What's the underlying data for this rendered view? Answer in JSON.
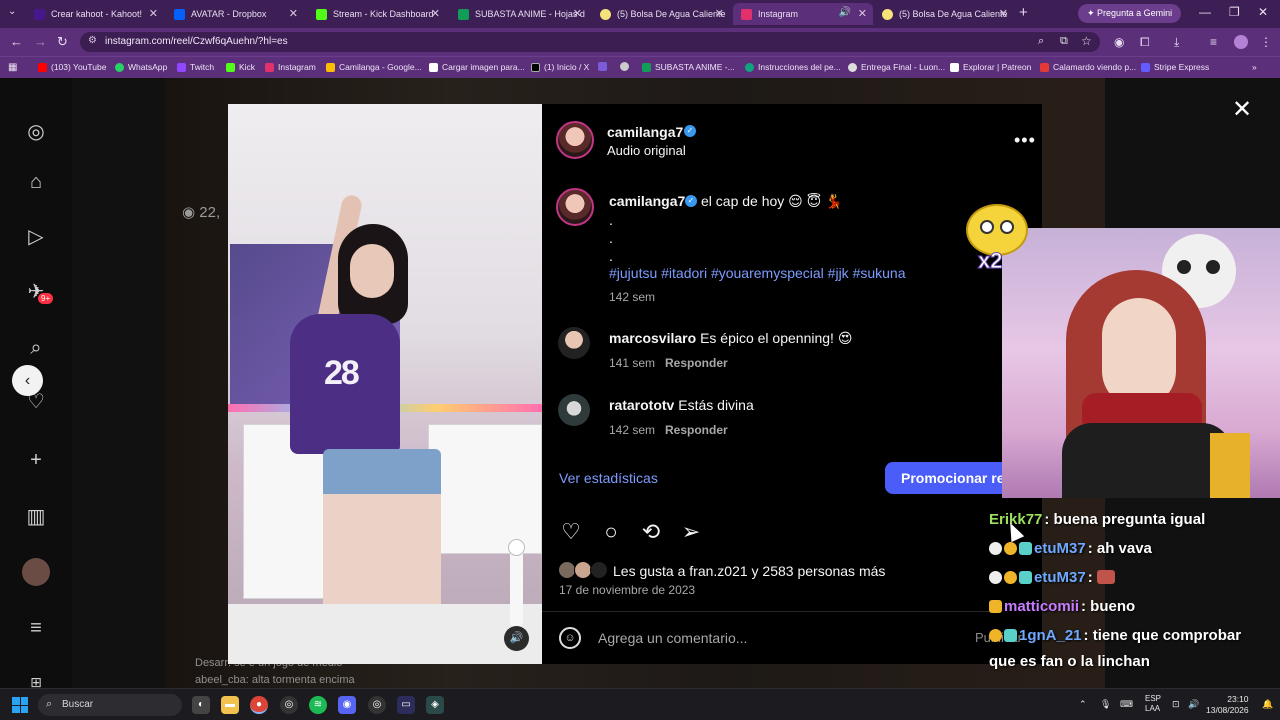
{
  "browser": {
    "tabs": [
      {
        "label": "Crear kahoot - Kahoot!",
        "color": "#46178f"
      },
      {
        "label": "AVATAR - Dropbox",
        "color": "#0061fe"
      },
      {
        "label": "Stream - Kick Dashboard",
        "color": "#53fc18"
      },
      {
        "label": "SUBASTA ANIME - Hojas d",
        "color": "#0f9d58"
      },
      {
        "label": "(5) Bolsa De Agua Caliente",
        "color": "#f5e27a"
      },
      {
        "label": "Instagram",
        "color": "#e1306c",
        "active": true
      },
      {
        "label": "(5) Bolsa De Agua Caliente",
        "color": "#f5e27a"
      }
    ],
    "new_tab": "+",
    "gemini_label": "Pregunta a Gemini",
    "url": "instagram.com/reel/Czwf6qAuehn/?hl=es",
    "bookmarks": [
      {
        "label": "(103) YouTube",
        "color": "#ff0000"
      },
      {
        "label": "WhatsApp",
        "color": "#25d366"
      },
      {
        "label": "Twitch",
        "color": "#9146ff"
      },
      {
        "label": "Kick",
        "color": "#53fc18"
      },
      {
        "label": "Instagram",
        "color": "#e1306c"
      },
      {
        "label": "Camilanga - Google...",
        "color": "#fbbc04"
      },
      {
        "label": "Cargar imagen para...",
        "color": "#ffffff"
      },
      {
        "label": "(1) Inicio / X",
        "color": "#000000"
      },
      {
        "label": "",
        "color": "#7b5bd6"
      },
      {
        "label": "",
        "color": "#cccccc"
      },
      {
        "label": "SUBASTA ANIME -...",
        "color": "#0f9d58"
      },
      {
        "label": "Instrucciones del pe...",
        "color": "#10a37f"
      },
      {
        "label": "Entrega Final - Luon...",
        "color": "#dddddd"
      },
      {
        "label": "Explorar | Patreon",
        "color": "#ffffff"
      },
      {
        "label": "Calamardo viendo p...",
        "color": "#e53935"
      },
      {
        "label": "Stripe Express",
        "color": "#635bff"
      }
    ]
  },
  "instagram": {
    "nav_badge": "9+",
    "background_views": "22,",
    "post": {
      "username": "camilanga7",
      "audio": "Audio original",
      "caption_text": "el cap de hoy 😌 😇 💃",
      "caption_dots": [
        ".",
        ".",
        "."
      ],
      "hashtags": "#jujutsu #itadori #youaremyspecial #jjk #sukuna",
      "caption_time": "142 sem",
      "comments": [
        {
          "user": "marcosvilaro",
          "text": "Es épico el openning! 😍",
          "time": "141 sem",
          "reply": "Responder"
        },
        {
          "user": "ratarototv",
          "text": "Estás divina",
          "time": "142 sem",
          "reply": "Responder"
        }
      ],
      "stats_link": "Ver estadísticas",
      "promote_button": "Promocionar ree",
      "likes_text": "Les gusta a fran.z021 y 2583 personas más",
      "date": "17 de noviembre de 2023",
      "comment_placeholder": "Agrega un comentario...",
      "publish_label": "Publicar"
    }
  },
  "stream_overlay": {
    "sticker_text": "x2",
    "chat": [
      {
        "user": "Erikk77",
        "user_color": "#9be15d",
        "message": ": buena pregunta igual"
      },
      {
        "user": "etuM37",
        "user_color": "#6ea8ff",
        "message": ": ah vava"
      },
      {
        "user": "etuM37",
        "user_color": "#6ea8ff",
        "message": ": "
      },
      {
        "user": "matticomii",
        "user_color": "#c77dff",
        "message": ": bueno"
      },
      {
        "user": "1gnA_21",
        "user_color": "#6ea8ff",
        "message": ": tiene que comprobar"
      },
      {
        "user": "",
        "user_color": "#ffffff",
        "message": "que es fan o la linchan"
      }
    ],
    "faded_chat": [
      {
        "user": "Desarr",
        "message": ": se e un jogo de medio"
      },
      {
        "user": "abeel_cba",
        "message": ": alta tormenta encima"
      }
    ]
  },
  "taskbar": {
    "search_label": "Buscar",
    "language_line1": "ESP",
    "language_line2": "LAA",
    "time": "23:10",
    "date": "13/08/2026"
  }
}
